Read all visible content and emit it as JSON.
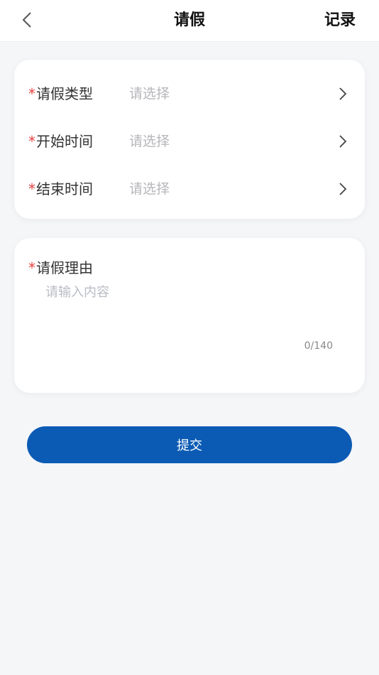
{
  "header": {
    "title": "请假",
    "record_label": "记录"
  },
  "form": {
    "required_mark": "*",
    "fields": [
      {
        "label": "请假类型",
        "placeholder": "请选择"
      },
      {
        "label": "开始时间",
        "placeholder": "请选择"
      },
      {
        "label": "结束时间",
        "placeholder": "请选择"
      }
    ],
    "reason": {
      "label": "请假理由",
      "placeholder": "请输入内容",
      "value": "",
      "counter": "0/140"
    },
    "submit_label": "提交"
  },
  "icons": {
    "back": "chevron-left-icon",
    "row_arrow": "chevron-right-icon"
  },
  "colors": {
    "primary": "#0b5bb5",
    "required": "#e5423f",
    "placeholder": "#b6b6bb"
  }
}
